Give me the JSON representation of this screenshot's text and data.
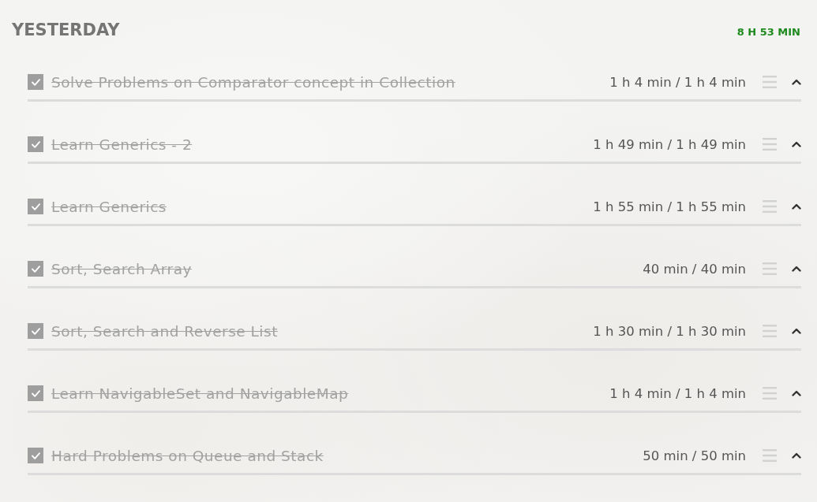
{
  "section": {
    "title": "YESTERDAY",
    "total": "8 H 53 MIN"
  },
  "items": [
    {
      "title": "Solve Problems on Comparator concept in Collection",
      "time": "1 h 4 min / 1 h 4 min",
      "checked": true
    },
    {
      "title": "Learn Generics - 2",
      "time": "1 h 49 min / 1 h 49 min",
      "checked": true
    },
    {
      "title": "Learn Generics",
      "time": "1 h 55 min / 1 h 55 min",
      "checked": true
    },
    {
      "title": "Sort, Search Array",
      "time": "40 min / 40 min",
      "checked": true
    },
    {
      "title": "Sort, Search and Reverse List",
      "time": "1 h 30 min / 1 h 30 min",
      "checked": true
    },
    {
      "title": "Learn NavigableSet and NavigableMap",
      "time": "1 h 4 min / 1 h 4 min",
      "checked": true
    },
    {
      "title": "Hard Problems on Queue and Stack",
      "time": "50 min / 50 min",
      "checked": true
    }
  ]
}
